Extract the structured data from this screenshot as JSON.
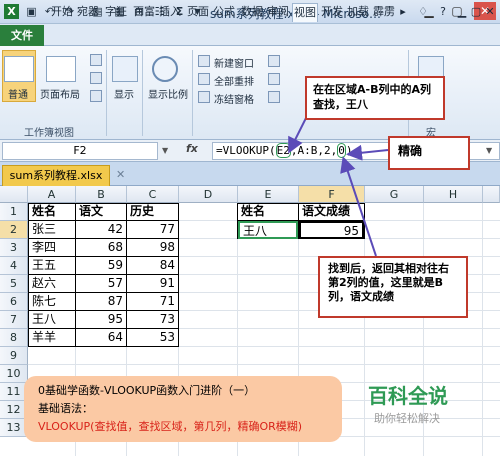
{
  "window": {
    "title": "sum系列教程.xlsx - Microso…",
    "quick_access": [
      "save-icon",
      "undo-icon",
      "redo-icon",
      "new-icon",
      "grid-icon",
      "sum-icon",
      "filter-icon"
    ],
    "quick_glyphs": [
      "▣",
      "↶",
      "↷",
      "▤",
      "▦",
      "Σ",
      "▼"
    ]
  },
  "tabs": [
    "文件",
    "开始",
    "宛器",
    "字狂",
    "百富",
    "插入",
    "页面",
    "公式",
    "数据",
    "审阅",
    "视图",
    "开发",
    "加载",
    "霹雳"
  ],
  "ribbon": {
    "normal": "普通",
    "page_layout": "页面布局",
    "workbook_views_group": "工作簿视图",
    "show": "显示",
    "zoom": "显示比例",
    "new_window": "新建窗口",
    "arrange_all": "全部重排",
    "freeze_panes": "冻结窗格",
    "macro_group": "宏"
  },
  "formula_bar": {
    "name_box": "F2",
    "fx": "fx",
    "formula_prefix": "=VLOOKUP(",
    "formula_arg1": "E2",
    "formula_sep1": ",",
    "formula_arg2": "A:B",
    "formula_sep2": ",",
    "formula_arg3": "2",
    "formula_sep3": ",",
    "formula_arg4": "0",
    "formula_suffix": ")"
  },
  "workbook_tab": "sum系列教程.xlsx",
  "columns": [
    "A",
    "B",
    "C",
    "D",
    "E",
    "F",
    "G",
    "H"
  ],
  "rows": [
    "1",
    "2",
    "3",
    "4",
    "5",
    "6",
    "7",
    "8",
    "9",
    "10",
    "11",
    "12",
    "13"
  ],
  "table": {
    "headers": [
      "姓名",
      "语文",
      "历史"
    ],
    "data": [
      [
        "张三",
        "42",
        "77"
      ],
      [
        "李四",
        "68",
        "98"
      ],
      [
        "王五",
        "59",
        "84"
      ],
      [
        "赵六",
        "57",
        "91"
      ],
      [
        "陈七",
        "87",
        "71"
      ],
      [
        "王八",
        "95",
        "73"
      ],
      [
        "羊羊",
        "64",
        "53"
      ]
    ]
  },
  "lookup": {
    "header_name": "姓名",
    "header_score": "语文成绩",
    "name": "王八",
    "result": "95"
  },
  "callouts": {
    "range_note": "在在区域A-B列中的A列查找，王八",
    "exact_note": "精确",
    "found_note": "找到后，返回其相对往右第2列的值，这里就是B列，语文成绩"
  },
  "footer": {
    "line1": "0基础学函数-VLOOKUP函数入门进阶（一）",
    "line2": "基础语法：",
    "line3": "VLOOKUP(查找值，查找区域，第几列，精确OR模糊)"
  },
  "watermark": {
    "brand": "百科全说",
    "slogan": "助你轻松解决"
  },
  "colors": {
    "accent_red": "#c0392b",
    "file_tab": "#2a7f3c",
    "arrow": "#5b4bb8",
    "brand_green": "#2f9a55"
  }
}
